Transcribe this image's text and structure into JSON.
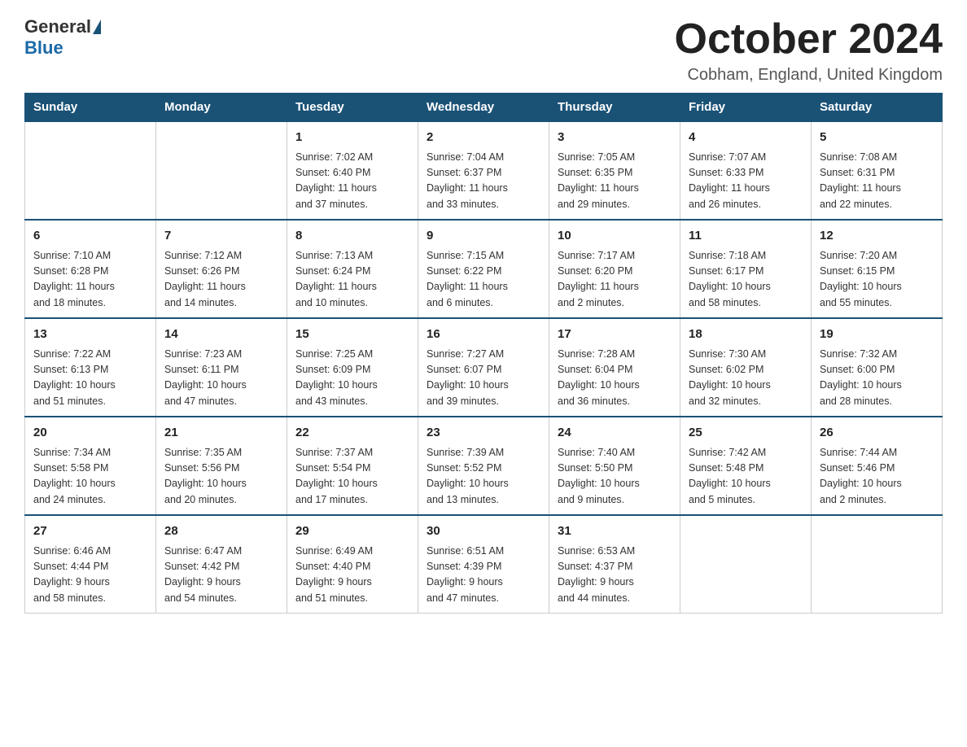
{
  "logo": {
    "general": "General",
    "blue": "Blue"
  },
  "title": "October 2024",
  "location": "Cobham, England, United Kingdom",
  "headers": [
    "Sunday",
    "Monday",
    "Tuesday",
    "Wednesday",
    "Thursday",
    "Friday",
    "Saturday"
  ],
  "weeks": [
    [
      {
        "day": "",
        "info": ""
      },
      {
        "day": "",
        "info": ""
      },
      {
        "day": "1",
        "info": "Sunrise: 7:02 AM\nSunset: 6:40 PM\nDaylight: 11 hours\nand 37 minutes."
      },
      {
        "day": "2",
        "info": "Sunrise: 7:04 AM\nSunset: 6:37 PM\nDaylight: 11 hours\nand 33 minutes."
      },
      {
        "day": "3",
        "info": "Sunrise: 7:05 AM\nSunset: 6:35 PM\nDaylight: 11 hours\nand 29 minutes."
      },
      {
        "day": "4",
        "info": "Sunrise: 7:07 AM\nSunset: 6:33 PM\nDaylight: 11 hours\nand 26 minutes."
      },
      {
        "day": "5",
        "info": "Sunrise: 7:08 AM\nSunset: 6:31 PM\nDaylight: 11 hours\nand 22 minutes."
      }
    ],
    [
      {
        "day": "6",
        "info": "Sunrise: 7:10 AM\nSunset: 6:28 PM\nDaylight: 11 hours\nand 18 minutes."
      },
      {
        "day": "7",
        "info": "Sunrise: 7:12 AM\nSunset: 6:26 PM\nDaylight: 11 hours\nand 14 minutes."
      },
      {
        "day": "8",
        "info": "Sunrise: 7:13 AM\nSunset: 6:24 PM\nDaylight: 11 hours\nand 10 minutes."
      },
      {
        "day": "9",
        "info": "Sunrise: 7:15 AM\nSunset: 6:22 PM\nDaylight: 11 hours\nand 6 minutes."
      },
      {
        "day": "10",
        "info": "Sunrise: 7:17 AM\nSunset: 6:20 PM\nDaylight: 11 hours\nand 2 minutes."
      },
      {
        "day": "11",
        "info": "Sunrise: 7:18 AM\nSunset: 6:17 PM\nDaylight: 10 hours\nand 58 minutes."
      },
      {
        "day": "12",
        "info": "Sunrise: 7:20 AM\nSunset: 6:15 PM\nDaylight: 10 hours\nand 55 minutes."
      }
    ],
    [
      {
        "day": "13",
        "info": "Sunrise: 7:22 AM\nSunset: 6:13 PM\nDaylight: 10 hours\nand 51 minutes."
      },
      {
        "day": "14",
        "info": "Sunrise: 7:23 AM\nSunset: 6:11 PM\nDaylight: 10 hours\nand 47 minutes."
      },
      {
        "day": "15",
        "info": "Sunrise: 7:25 AM\nSunset: 6:09 PM\nDaylight: 10 hours\nand 43 minutes."
      },
      {
        "day": "16",
        "info": "Sunrise: 7:27 AM\nSunset: 6:07 PM\nDaylight: 10 hours\nand 39 minutes."
      },
      {
        "day": "17",
        "info": "Sunrise: 7:28 AM\nSunset: 6:04 PM\nDaylight: 10 hours\nand 36 minutes."
      },
      {
        "day": "18",
        "info": "Sunrise: 7:30 AM\nSunset: 6:02 PM\nDaylight: 10 hours\nand 32 minutes."
      },
      {
        "day": "19",
        "info": "Sunrise: 7:32 AM\nSunset: 6:00 PM\nDaylight: 10 hours\nand 28 minutes."
      }
    ],
    [
      {
        "day": "20",
        "info": "Sunrise: 7:34 AM\nSunset: 5:58 PM\nDaylight: 10 hours\nand 24 minutes."
      },
      {
        "day": "21",
        "info": "Sunrise: 7:35 AM\nSunset: 5:56 PM\nDaylight: 10 hours\nand 20 minutes."
      },
      {
        "day": "22",
        "info": "Sunrise: 7:37 AM\nSunset: 5:54 PM\nDaylight: 10 hours\nand 17 minutes."
      },
      {
        "day": "23",
        "info": "Sunrise: 7:39 AM\nSunset: 5:52 PM\nDaylight: 10 hours\nand 13 minutes."
      },
      {
        "day": "24",
        "info": "Sunrise: 7:40 AM\nSunset: 5:50 PM\nDaylight: 10 hours\nand 9 minutes."
      },
      {
        "day": "25",
        "info": "Sunrise: 7:42 AM\nSunset: 5:48 PM\nDaylight: 10 hours\nand 5 minutes."
      },
      {
        "day": "26",
        "info": "Sunrise: 7:44 AM\nSunset: 5:46 PM\nDaylight: 10 hours\nand 2 minutes."
      }
    ],
    [
      {
        "day": "27",
        "info": "Sunrise: 6:46 AM\nSunset: 4:44 PM\nDaylight: 9 hours\nand 58 minutes."
      },
      {
        "day": "28",
        "info": "Sunrise: 6:47 AM\nSunset: 4:42 PM\nDaylight: 9 hours\nand 54 minutes."
      },
      {
        "day": "29",
        "info": "Sunrise: 6:49 AM\nSunset: 4:40 PM\nDaylight: 9 hours\nand 51 minutes."
      },
      {
        "day": "30",
        "info": "Sunrise: 6:51 AM\nSunset: 4:39 PM\nDaylight: 9 hours\nand 47 minutes."
      },
      {
        "day": "31",
        "info": "Sunrise: 6:53 AM\nSunset: 4:37 PM\nDaylight: 9 hours\nand 44 minutes."
      },
      {
        "day": "",
        "info": ""
      },
      {
        "day": "",
        "info": ""
      }
    ]
  ]
}
